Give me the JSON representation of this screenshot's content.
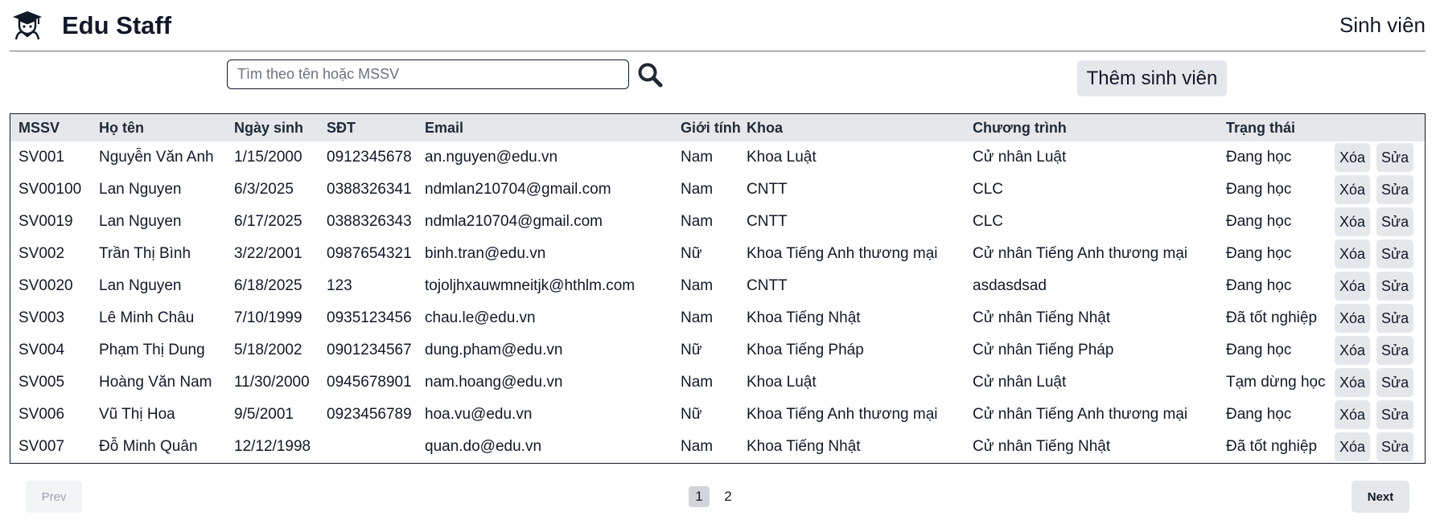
{
  "header": {
    "brand": "Edu Staff",
    "logo_icon": "graduate-student-icon",
    "section_title": "Sinh viên"
  },
  "search": {
    "placeholder": "Tìm theo tên hoặc MSSV",
    "value": "",
    "icon": "search-icon"
  },
  "add_button_label": "Thêm sinh viên",
  "table": {
    "columns": [
      "MSSV",
      "Họ tên",
      "Ngày sinh",
      "SĐT",
      "Email",
      "Giới tính",
      "Khoa",
      "Chương trình",
      "Trạng thái"
    ],
    "rows": [
      [
        "SV001",
        "Nguyễn Văn Anh",
        "1/15/2000",
        "0912345678",
        "an.nguyen@edu.vn",
        "Nam",
        "Khoa Luật",
        "Cử nhân Luật",
        "Đang học"
      ],
      [
        "SV00100",
        "Lan Nguyen",
        "6/3/2025",
        "0388326341",
        "ndmlan210704@gmail.com",
        "Nam",
        "CNTT",
        "CLC",
        "Đang học"
      ],
      [
        "SV0019",
        "Lan Nguyen",
        "6/17/2025",
        "0388326343",
        "ndmla210704@gmail.com",
        "Nam",
        "CNTT",
        "CLC",
        "Đang học"
      ],
      [
        "SV002",
        "Trần Thị Bình",
        "3/22/2001",
        "0987654321",
        "binh.tran@edu.vn",
        "Nữ",
        "Khoa Tiếng Anh thương mại",
        "Cử nhân Tiếng Anh thương mại",
        "Đang học"
      ],
      [
        "SV0020",
        "Lan Nguyen",
        "6/18/2025",
        "123",
        "tojoljhxauwmneitjk@hthlm.com",
        "Nam",
        "CNTT",
        "asdasdsad",
        "Đang học"
      ],
      [
        "SV003",
        "Lê Minh Châu",
        "7/10/1999",
        "0935123456",
        "chau.le@edu.vn",
        "Nam",
        "Khoa Tiếng Nhật",
        "Cử nhân Tiếng Nhật",
        "Đã tốt nghiệp"
      ],
      [
        "SV004",
        "Phạm Thị Dung",
        "5/18/2002",
        "0901234567",
        "dung.pham@edu.vn",
        "Nữ",
        "Khoa Tiếng Pháp",
        "Cử nhân Tiếng Pháp",
        "Đang học"
      ],
      [
        "SV005",
        "Hoàng Văn Nam",
        "11/30/2000",
        "0945678901",
        "nam.hoang@edu.vn",
        "Nam",
        "Khoa Luật",
        "Cử nhân Luật",
        "Tạm dừng học"
      ],
      [
        "SV006",
        "Vũ Thị Hoa",
        "9/5/2001",
        "0923456789",
        "hoa.vu@edu.vn",
        "Nữ",
        "Khoa Tiếng Anh thương mại",
        "Cử nhân Tiếng Anh thương mại",
        "Đang học"
      ],
      [
        "SV007",
        "Đỗ Minh Quân",
        "12/12/1998",
        "",
        "quan.do@edu.vn",
        "Nam",
        "Khoa Tiếng Nhật",
        "Cử nhân Tiếng Nhật",
        "Đã tốt nghiệp"
      ]
    ],
    "delete_label": "Xóa",
    "edit_label": "Sửa"
  },
  "pagination": {
    "prev_label": "Prev",
    "next_label": "Next",
    "pages": [
      "1",
      "2"
    ],
    "current_page": "1"
  },
  "colors": {
    "header_row_bg": "#e5e7eb",
    "button_bg": "#e5e7eb",
    "active_page_bg": "#d1d5db",
    "text": "#111827"
  }
}
